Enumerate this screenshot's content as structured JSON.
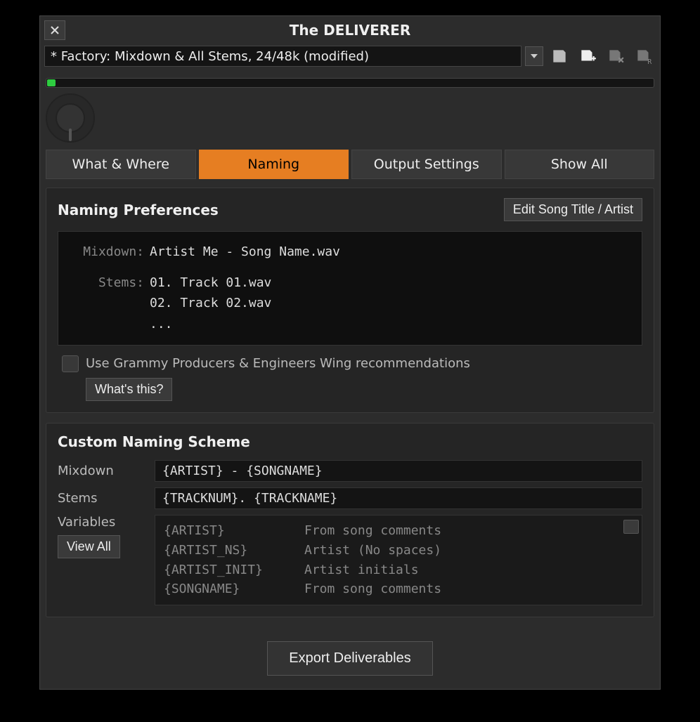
{
  "title": "The DELIVERER",
  "preset": "* Factory: Mixdown & All Stems, 24/48k (modified)",
  "tabs": {
    "what_where": "What & Where",
    "naming": "Naming",
    "output": "Output Settings",
    "show_all": "Show All"
  },
  "naming_prefs": {
    "title": "Naming Preferences",
    "edit_btn": "Edit Song Title / Artist",
    "mixdown_label": "Mixdown:",
    "mixdown_value": "Artist Me - Song Name.wav",
    "stems_label": "Stems:",
    "stems_line1": "01. Track 01.wav",
    "stems_line2": "02. Track 02.wav",
    "stems_line3": "...",
    "grammy_check": "Use Grammy Producers & Engineers Wing recommendations",
    "whats_this": "What's this?"
  },
  "custom_scheme": {
    "title": "Custom Naming Scheme",
    "mixdown_label": "Mixdown",
    "mixdown_value": "{ARTIST} - {SONGNAME}",
    "stems_label": "Stems",
    "stems_value": "{TRACKNUM}. {TRACKNAME}",
    "variables_label": "Variables",
    "view_all": "View All",
    "vars": [
      {
        "name": "{ARTIST}",
        "desc": "From song comments"
      },
      {
        "name": "{ARTIST_NS}",
        "desc": "Artist (No spaces)"
      },
      {
        "name": "{ARTIST_INIT}",
        "desc": "Artist initials"
      },
      {
        "name": "{SONGNAME}",
        "desc": "From song comments"
      }
    ]
  },
  "export_btn": "Export Deliverables"
}
